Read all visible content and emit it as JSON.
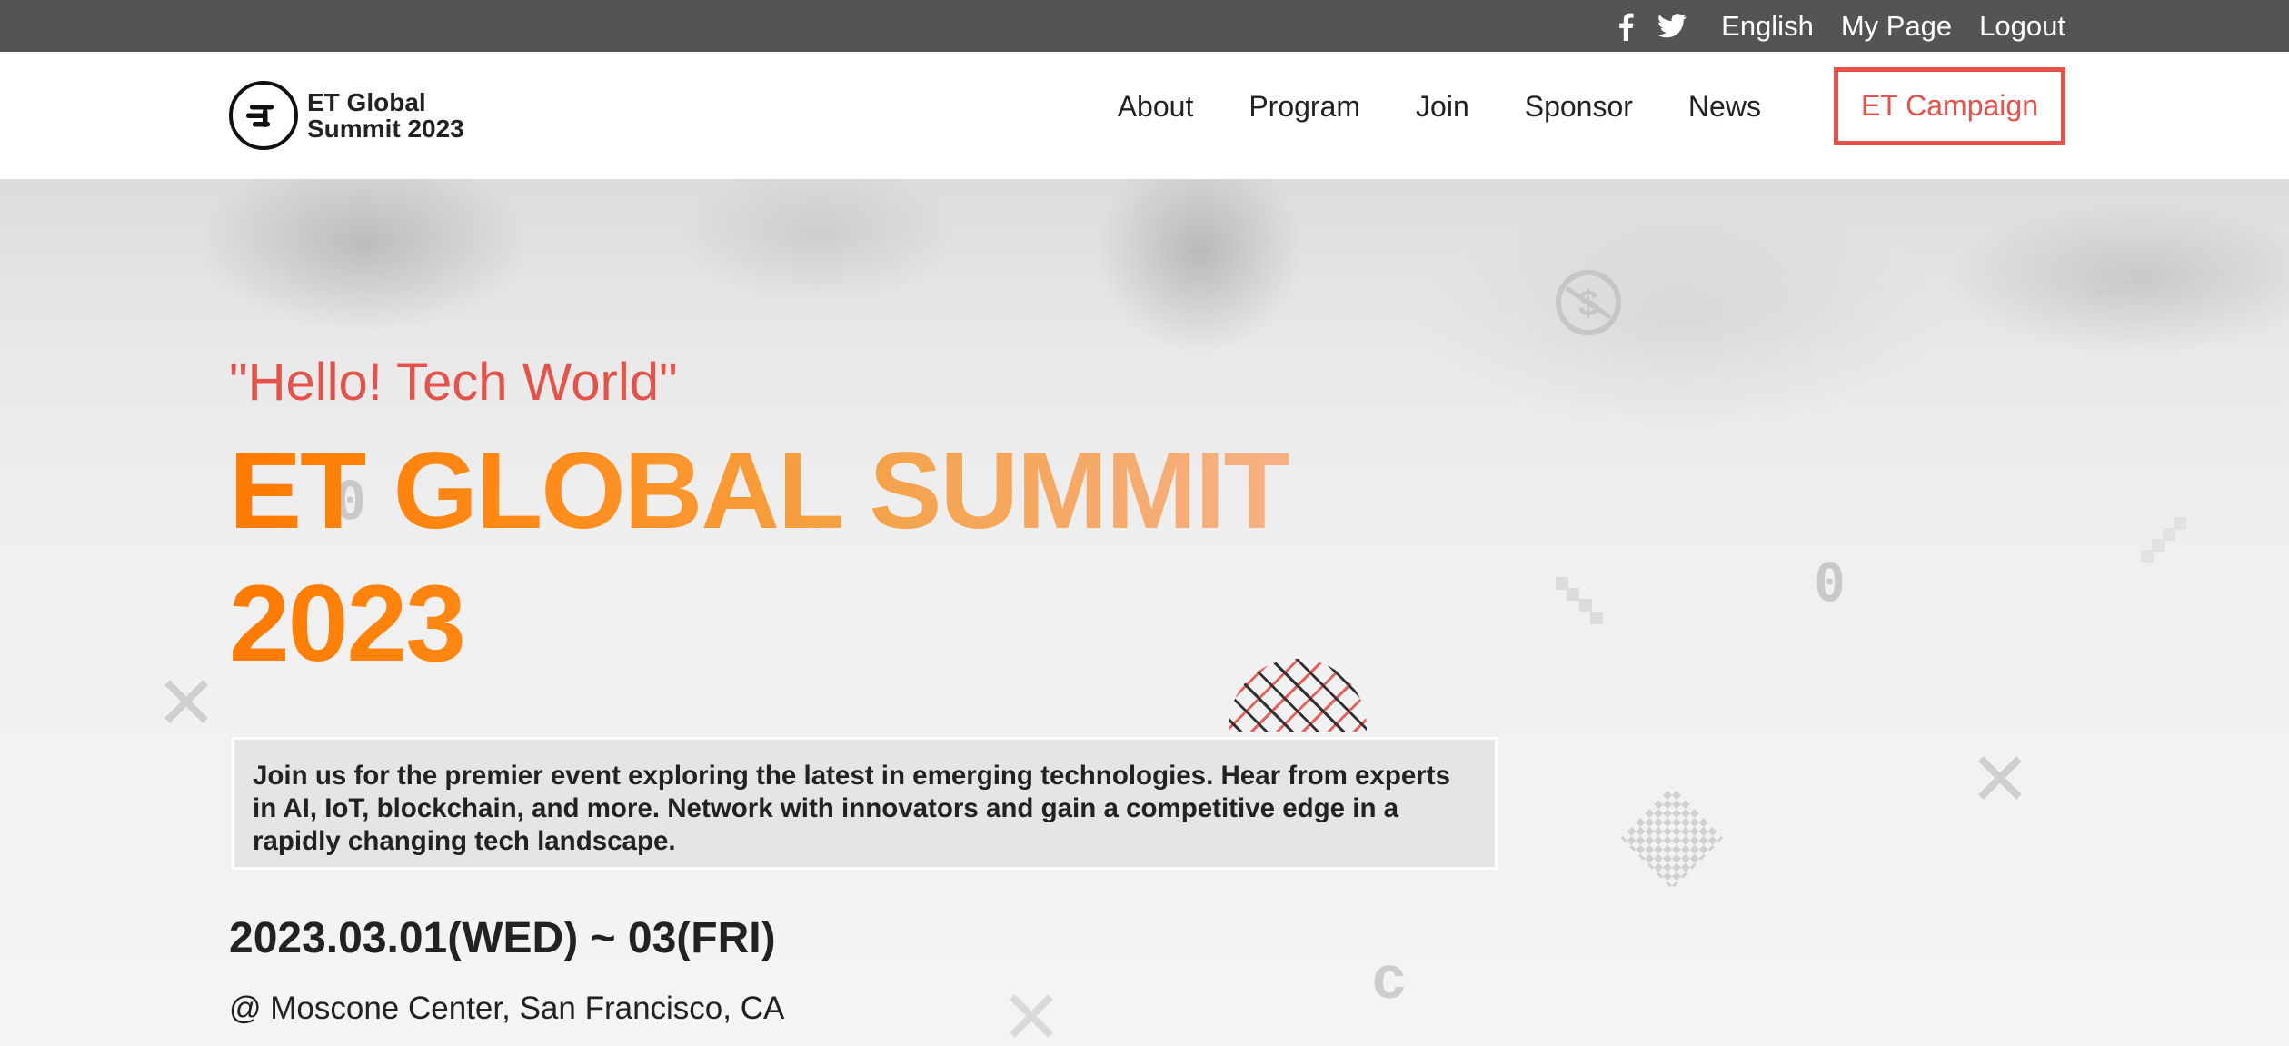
{
  "topbar": {
    "social": [
      {
        "icon": "facebook-icon"
      },
      {
        "icon": "twitter-icon"
      }
    ],
    "language": "English",
    "my_page": "My Page",
    "logout": "Logout"
  },
  "header": {
    "logo_line1": "ET Global",
    "logo_line2": "Summit 2023",
    "nav": [
      "About",
      "Program",
      "Join",
      "Sponsor",
      "News"
    ],
    "campaign": "ET Campaign"
  },
  "hero": {
    "tagline": "\"Hello! Tech World\"",
    "title_line1": "ET GLOBAL SUMMIT",
    "title_line2": "2023",
    "intro": "Join us for the premier event exploring the latest in emerging technologies. Hear from experts in AI, IoT, blockchain, and more. Network with innovators and gain a competitive edge in a rapidly changing tech landscape.",
    "dates": "2023.03.01(WED) ~ 03(FRI)",
    "venue": "@ Moscone Center, San Francisco, CA"
  },
  "colors": {
    "accent": "#e4524a",
    "title_gradient_start": "#ff7a00",
    "title_gradient_end": "#f6b28a",
    "topbar_bg": "#545454"
  }
}
